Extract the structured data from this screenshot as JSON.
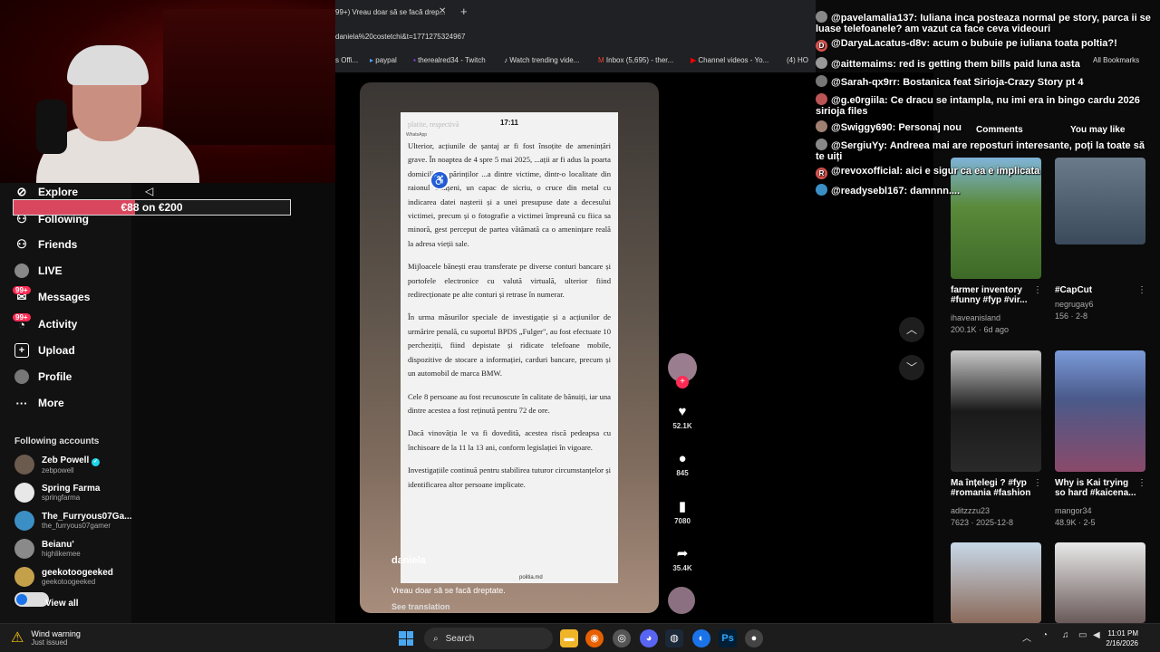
{
  "donation": {
    "text": "€88 on €200",
    "progress_percent": 44
  },
  "sidebar": {
    "items": [
      {
        "label": "Explore",
        "icon": "compass-icon"
      },
      {
        "label": "Following",
        "icon": "following-icon"
      },
      {
        "label": "Friends",
        "icon": "friends-icon"
      },
      {
        "label": "LIVE",
        "icon": "live-icon"
      },
      {
        "label": "Messages",
        "icon": "messages-icon",
        "badge": "99+"
      },
      {
        "label": "Activity",
        "icon": "activity-icon",
        "badge": "99+"
      },
      {
        "label": "Upload",
        "icon": "upload-icon"
      },
      {
        "label": "Profile",
        "icon": "profile-icon"
      },
      {
        "label": "More",
        "icon": "more-icon"
      }
    ],
    "following_title": "Following accounts",
    "accounts": [
      {
        "name": "Zeb Powell",
        "handle": "zebpowell",
        "verified": true,
        "color": "#6b5a4e"
      },
      {
        "name": "Spring Farma",
        "handle": "springfarma",
        "color": "#e8e8e8"
      },
      {
        "name": "The_Furryous07Ga...",
        "handle": "the_furryous07gamer",
        "color": "#3b8fc4"
      },
      {
        "name": "Beianu'",
        "handle": "highlikemee",
        "color": "#8a8a8a"
      },
      {
        "name": "geekotoogeeked",
        "handle": "geekotoogeeked",
        "color": "#c4a04a"
      }
    ],
    "view_all": "View all"
  },
  "browser": {
    "tab_title": "99+) Vreau doar să se facă drep...",
    "url": "daniela%20costetchi&t=1771275324967",
    "bookmarks": [
      "s Offi...",
      "paypal",
      "therealred34 - Twitch",
      "Watch trending vide...",
      "Inbox (5,695) - ther...",
      "Channel videos - Yo...",
      "(4) HO"
    ],
    "all_bookmarks": "All Bookmarks"
  },
  "video": {
    "status_time": "17:11",
    "app_label": "WhatsApp",
    "ghost_header": "platite, respectivă",
    "paragraphs": [
      "Ulterior, acțiunile de șantaj ar fi fost însoțite de amenințări grave. În noaptea de 4 spre 5 mai 2025, ...ații ar fi adus la poarta domiciliului părinților ...a dintre victime, dintr-o localitate din raionul Căușeni, un capac de sicriu, o cruce din metal cu indicarea datei nașterii și a unei presupuse date a decesului victimei, precum și o fotografie a victimei împreună cu fiica sa minoră, gest perceput de partea vătămată ca o amenințare reală la adresa vieții sale.",
      "Mijloacele bănești erau transferate pe diverse conturi bancare și portofele electronice cu valută virtuală, ulterior fiind redirecționate pe alte conturi și retrase în numerar.",
      "În urma măsurilor speciale de investigație și a acțiunilor de urmărire penală, cu suportul BPDS „Fulger\", au fost efectuate 10 percheziții, fiind depistate și ridicate telefoane mobile, dispozitive de stocare a informației, carduri bancare, precum și un automobil de marca BMW.",
      "Cele 8 persoane au fost recunoscute în calitate de bănuiți, iar una dintre acestea a fost reținută pentru 72 de ore.",
      "Dacă vinovăția le va fi dovedită, acestea riscă pedeapsa cu închisoare de la 11 la 13 ani, conform legislației în vigoare.",
      "Investigațiile continuă pentru stabilirea tuturor circumstanțelor și identificarea altor persoane implicate."
    ],
    "source": "politia.md",
    "username": "daniela",
    "caption": "Vreau doar să se facă dreptate.",
    "translate": "See translation",
    "likes": "52.1K",
    "comments": "845",
    "saves": "7080",
    "shares": "35.4K"
  },
  "chat": [
    {
      "user": "@pavelamalia137:",
      "text": "Iuliana inca posteaza normal pe story, parca ii se luase telefoanele? am vazut ca face ceva videouri",
      "color": "#888888"
    },
    {
      "user": "@DaryaLacatus-d8v:",
      "text": "acum o bubuie pe iuliana toata poltia?!",
      "color": "#d9534f",
      "initial": "D"
    },
    {
      "user": "@aittemaims:",
      "text": "red is getting them bills paid luna asta",
      "color": "#999999"
    },
    {
      "user": "@Sarah-qx9rr:",
      "text": "Bostanica feat Sirioja-Crazy Story pt 4",
      "color": "#777777"
    },
    {
      "user": "@g.e0rgiila:",
      "text": "Ce dracu se intampla, nu imi era in bingo cardu 2026 sirioja files",
      "color": "#b55"
    },
    {
      "user": "@Swiggy690:",
      "text": "Personaj nou",
      "color": "#a08070"
    },
    {
      "user": "@SergiuYy:",
      "text": "Andreea mai are reposturi interesante, poți la toate să te uiți",
      "color": "#888888"
    },
    {
      "user": "@revoxofficial:",
      "text": "aici e sigur ca ea e implicata",
      "color": "#d9534f",
      "initial": "R"
    },
    {
      "user": "@readysebl167:",
      "text": "damnnn....",
      "color": "#3b8fc4"
    }
  ],
  "right_panel": {
    "tab_comments": "Comments",
    "tab_you_may_like": "You may like",
    "videos": [
      {
        "title": "farmer inventory #funny #fyp #vir...",
        "author": "ihaveanisland",
        "stats": "200.1K · 6d ago",
        "color": "#5a8a3a"
      },
      {
        "title": "#CapCut",
        "author": "negrugay6",
        "stats": "156 · 2-8",
        "color": "#4a5a6a"
      },
      {
        "title": "Ma înțelegi ? #fyp #romania #fashion",
        "author": "aditzzzu23",
        "stats": "7623 · 2025-12-8",
        "color": "#2a2a2a"
      },
      {
        "title": "Why is Kai trying so hard #kaicena...",
        "author": "mangor34",
        "stats": "48.9K · 2-5",
        "color": "#5a6a9a"
      },
      {
        "title": "",
        "author": "",
        "stats": "",
        "color": "#8a6a5a"
      },
      {
        "title": "",
        "author": "",
        "stats": "",
        "color": "#6a5a5a"
      }
    ]
  },
  "taskbar": {
    "weather_title": "Wind warning",
    "weather_sub": "Just issued",
    "search_placeholder": "Search",
    "time": "11:01 PM",
    "date": "2/16/2026"
  }
}
